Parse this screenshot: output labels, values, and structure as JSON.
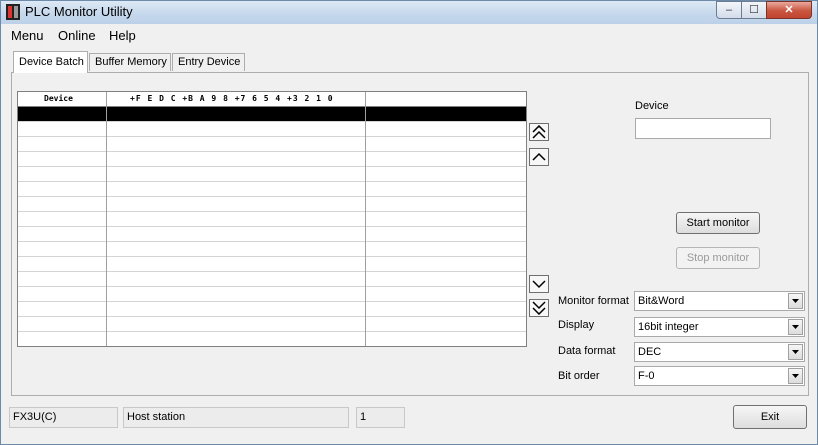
{
  "window": {
    "title": "PLC Monitor Utility",
    "min_glyph": "–",
    "max_glyph": "☐",
    "close_glyph": "✕"
  },
  "menu": [
    "Menu",
    "Online",
    "Help"
  ],
  "tabs": [
    "Device Batch",
    "Buffer Memory",
    "Entry Device"
  ],
  "grid": {
    "header_device": "Device",
    "header_bits": "+F E D C +B A 9 8 +7 6 5 4 +3 2 1 0",
    "header_value": "",
    "row_count": 15
  },
  "device": {
    "label": "Device",
    "value": ""
  },
  "buttons": {
    "start": "Start monitor",
    "stop": "Stop monitor",
    "exit": "Exit"
  },
  "settings": [
    {
      "label": "Monitor format",
      "value": "Bit&Word"
    },
    {
      "label": "Display",
      "value": "16bit integer"
    },
    {
      "label": "Data format",
      "value": "DEC"
    },
    {
      "label": "Bit order",
      "value": "F-0"
    }
  ],
  "status": {
    "plc": "FX3U(C)",
    "station": "Host station",
    "number": "1"
  },
  "colors": {
    "selected_row": "#000000",
    "titlebar": "#c4d7ec",
    "close_button": "#c95540"
  }
}
